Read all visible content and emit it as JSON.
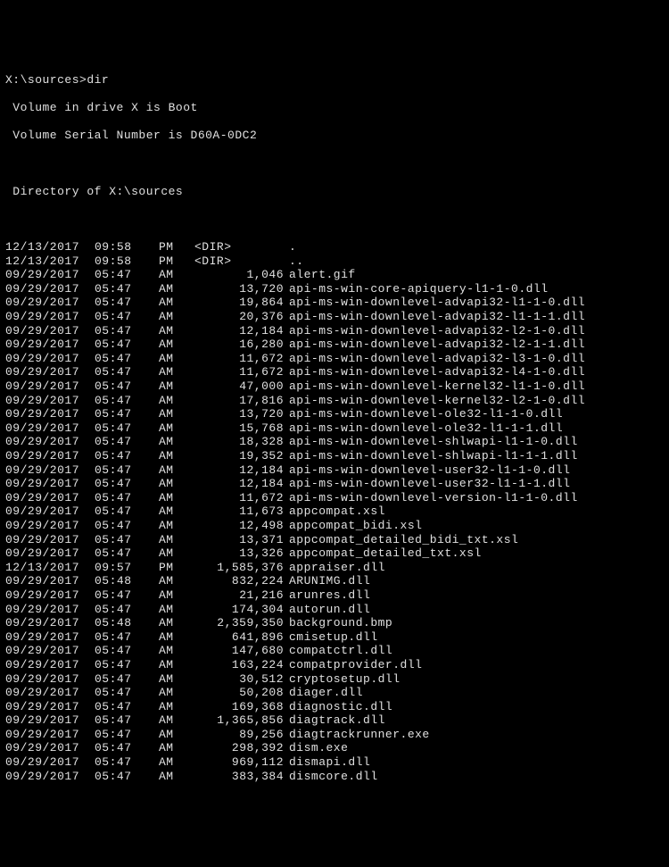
{
  "prompt": "X:\\sources>dir",
  "volume_label": " Volume in drive X is Boot",
  "volume_serial": " Volume Serial Number is D60A-0DC2",
  "directory_of": " Directory of X:\\sources",
  "dir_marker": "<DIR>",
  "entries": [
    {
      "date": "12/13/2017",
      "time": "09:58",
      "ampm": "PM",
      "size": "",
      "isdir": true,
      "name": "."
    },
    {
      "date": "12/13/2017",
      "time": "09:58",
      "ampm": "PM",
      "size": "",
      "isdir": true,
      "name": ".."
    },
    {
      "date": "09/29/2017",
      "time": "05:47",
      "ampm": "AM",
      "size": "1,046",
      "isdir": false,
      "name": "alert.gif"
    },
    {
      "date": "09/29/2017",
      "time": "05:47",
      "ampm": "AM",
      "size": "13,720",
      "isdir": false,
      "name": "api-ms-win-core-apiquery-l1-1-0.dll"
    },
    {
      "date": "09/29/2017",
      "time": "05:47",
      "ampm": "AM",
      "size": "19,864",
      "isdir": false,
      "name": "api-ms-win-downlevel-advapi32-l1-1-0.dll"
    },
    {
      "date": "09/29/2017",
      "time": "05:47",
      "ampm": "AM",
      "size": "20,376",
      "isdir": false,
      "name": "api-ms-win-downlevel-advapi32-l1-1-1.dll"
    },
    {
      "date": "09/29/2017",
      "time": "05:47",
      "ampm": "AM",
      "size": "12,184",
      "isdir": false,
      "name": "api-ms-win-downlevel-advapi32-l2-1-0.dll"
    },
    {
      "date": "09/29/2017",
      "time": "05:47",
      "ampm": "AM",
      "size": "16,280",
      "isdir": false,
      "name": "api-ms-win-downlevel-advapi32-l2-1-1.dll"
    },
    {
      "date": "09/29/2017",
      "time": "05:47",
      "ampm": "AM",
      "size": "11,672",
      "isdir": false,
      "name": "api-ms-win-downlevel-advapi32-l3-1-0.dll"
    },
    {
      "date": "09/29/2017",
      "time": "05:47",
      "ampm": "AM",
      "size": "11,672",
      "isdir": false,
      "name": "api-ms-win-downlevel-advapi32-l4-1-0.dll"
    },
    {
      "date": "09/29/2017",
      "time": "05:47",
      "ampm": "AM",
      "size": "47,000",
      "isdir": false,
      "name": "api-ms-win-downlevel-kernel32-l1-1-0.dll"
    },
    {
      "date": "09/29/2017",
      "time": "05:47",
      "ampm": "AM",
      "size": "17,816",
      "isdir": false,
      "name": "api-ms-win-downlevel-kernel32-l2-1-0.dll"
    },
    {
      "date": "09/29/2017",
      "time": "05:47",
      "ampm": "AM",
      "size": "13,720",
      "isdir": false,
      "name": "api-ms-win-downlevel-ole32-l1-1-0.dll"
    },
    {
      "date": "09/29/2017",
      "time": "05:47",
      "ampm": "AM",
      "size": "15,768",
      "isdir": false,
      "name": "api-ms-win-downlevel-ole32-l1-1-1.dll"
    },
    {
      "date": "09/29/2017",
      "time": "05:47",
      "ampm": "AM",
      "size": "18,328",
      "isdir": false,
      "name": "api-ms-win-downlevel-shlwapi-l1-1-0.dll"
    },
    {
      "date": "09/29/2017",
      "time": "05:47",
      "ampm": "AM",
      "size": "19,352",
      "isdir": false,
      "name": "api-ms-win-downlevel-shlwapi-l1-1-1.dll"
    },
    {
      "date": "09/29/2017",
      "time": "05:47",
      "ampm": "AM",
      "size": "12,184",
      "isdir": false,
      "name": "api-ms-win-downlevel-user32-l1-1-0.dll"
    },
    {
      "date": "09/29/2017",
      "time": "05:47",
      "ampm": "AM",
      "size": "12,184",
      "isdir": false,
      "name": "api-ms-win-downlevel-user32-l1-1-1.dll"
    },
    {
      "date": "09/29/2017",
      "time": "05:47",
      "ampm": "AM",
      "size": "11,672",
      "isdir": false,
      "name": "api-ms-win-downlevel-version-l1-1-0.dll"
    },
    {
      "date": "09/29/2017",
      "time": "05:47",
      "ampm": "AM",
      "size": "11,673",
      "isdir": false,
      "name": "appcompat.xsl"
    },
    {
      "date": "09/29/2017",
      "time": "05:47",
      "ampm": "AM",
      "size": "12,498",
      "isdir": false,
      "name": "appcompat_bidi.xsl"
    },
    {
      "date": "09/29/2017",
      "time": "05:47",
      "ampm": "AM",
      "size": "13,371",
      "isdir": false,
      "name": "appcompat_detailed_bidi_txt.xsl"
    },
    {
      "date": "09/29/2017",
      "time": "05:47",
      "ampm": "AM",
      "size": "13,326",
      "isdir": false,
      "name": "appcompat_detailed_txt.xsl"
    },
    {
      "date": "12/13/2017",
      "time": "09:57",
      "ampm": "PM",
      "size": "1,585,376",
      "isdir": false,
      "name": "appraiser.dll"
    },
    {
      "date": "09/29/2017",
      "time": "05:48",
      "ampm": "AM",
      "size": "832,224",
      "isdir": false,
      "name": "ARUNIMG.dll"
    },
    {
      "date": "09/29/2017",
      "time": "05:47",
      "ampm": "AM",
      "size": "21,216",
      "isdir": false,
      "name": "arunres.dll"
    },
    {
      "date": "09/29/2017",
      "time": "05:47",
      "ampm": "AM",
      "size": "174,304",
      "isdir": false,
      "name": "autorun.dll"
    },
    {
      "date": "09/29/2017",
      "time": "05:48",
      "ampm": "AM",
      "size": "2,359,350",
      "isdir": false,
      "name": "background.bmp"
    },
    {
      "date": "09/29/2017",
      "time": "05:47",
      "ampm": "AM",
      "size": "641,896",
      "isdir": false,
      "name": "cmisetup.dll"
    },
    {
      "date": "09/29/2017",
      "time": "05:47",
      "ampm": "AM",
      "size": "147,680",
      "isdir": false,
      "name": "compatctrl.dll"
    },
    {
      "date": "09/29/2017",
      "time": "05:47",
      "ampm": "AM",
      "size": "163,224",
      "isdir": false,
      "name": "compatprovider.dll"
    },
    {
      "date": "09/29/2017",
      "time": "05:47",
      "ampm": "AM",
      "size": "30,512",
      "isdir": false,
      "name": "cryptosetup.dll"
    },
    {
      "date": "09/29/2017",
      "time": "05:47",
      "ampm": "AM",
      "size": "50,208",
      "isdir": false,
      "name": "diager.dll"
    },
    {
      "date": "09/29/2017",
      "time": "05:47",
      "ampm": "AM",
      "size": "169,368",
      "isdir": false,
      "name": "diagnostic.dll"
    },
    {
      "date": "09/29/2017",
      "time": "05:47",
      "ampm": "AM",
      "size": "1,365,856",
      "isdir": false,
      "name": "diagtrack.dll"
    },
    {
      "date": "09/29/2017",
      "time": "05:47",
      "ampm": "AM",
      "size": "89,256",
      "isdir": false,
      "name": "diagtrackrunner.exe"
    },
    {
      "date": "09/29/2017",
      "time": "05:47",
      "ampm": "AM",
      "size": "298,392",
      "isdir": false,
      "name": "dism.exe"
    },
    {
      "date": "09/29/2017",
      "time": "05:47",
      "ampm": "AM",
      "size": "969,112",
      "isdir": false,
      "name": "dismapi.dll"
    },
    {
      "date": "09/29/2017",
      "time": "05:47",
      "ampm": "AM",
      "size": "383,384",
      "isdir": false,
      "name": "dismcore.dll"
    }
  ]
}
